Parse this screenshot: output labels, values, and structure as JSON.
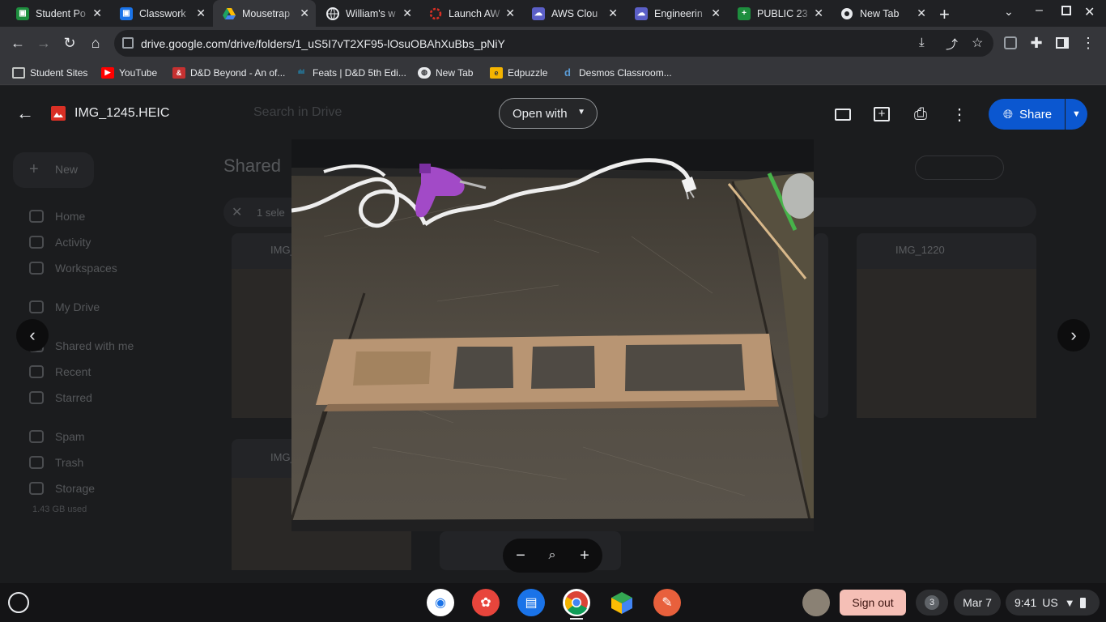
{
  "tabs": [
    {
      "title": "Student Po",
      "favicon": "classroom-green-icon"
    },
    {
      "title": "Classwork",
      "favicon": "classroom-blue-icon"
    },
    {
      "title": "Mousetrap",
      "favicon": "google-drive-icon",
      "active": true
    },
    {
      "title": "William's w",
      "favicon": "globe-icon"
    },
    {
      "title": "Launch AW",
      "favicon": "aws-launch-icon"
    },
    {
      "title": "AWS Clou",
      "favicon": "aws-cloud-icon"
    },
    {
      "title": "Engineerin",
      "favicon": "engineering-cloud-icon"
    },
    {
      "title": "PUBLIC 23",
      "favicon": "google-sheets-icon"
    },
    {
      "title": "New Tab",
      "favicon": "chrome-icon"
    }
  ],
  "address_bar": {
    "url": "drive.google.com/drive/folders/1_uS5I7vT2XF95-lOsuOBAhXuBbs_pNiY"
  },
  "bookmarks": [
    {
      "label": "Student Sites",
      "icon": "folder-icon"
    },
    {
      "label": "YouTube",
      "icon": "youtube-icon"
    },
    {
      "label": "D&D Beyond - An of...",
      "icon": "dnd-beyond-icon"
    },
    {
      "label": "Feats | D&D 5th Edi...",
      "icon": "cisco-icon"
    },
    {
      "label": "New Tab",
      "icon": "globe-icon"
    },
    {
      "label": "Edpuzzle",
      "icon": "edpuzzle-icon"
    },
    {
      "label": "Desmos Classroom...",
      "icon": "desmos-icon"
    }
  ],
  "viewer": {
    "file_name": "IMG_1245.HEIC",
    "open_with_label": "Open with",
    "share_label": "Share"
  },
  "drive_background": {
    "search_placeholder": "Search in Drive",
    "new_label": "New",
    "section_title": "Shared",
    "selection_text": "1 sele",
    "nav": [
      "Home",
      "Activity",
      "Workspaces",
      "My Drive",
      "Shared with me",
      "Recent",
      "Starred",
      "Spam",
      "Trash",
      "Storage"
    ],
    "storage_used": "1.43 GB used",
    "file_cards": [
      "IMG_",
      "IMG_1220",
      "IMG_"
    ]
  },
  "shelf": {
    "apps": [
      "chrome-remote-icon",
      "paint-icon",
      "classroom-app-icon",
      "chrome-browser-icon",
      "3d-cube-icon",
      "pencil-app-icon"
    ],
    "sign_out_label": "Sign out",
    "notification_count": "3",
    "date": "Mar 7",
    "time": "9:41",
    "locale": "US"
  }
}
